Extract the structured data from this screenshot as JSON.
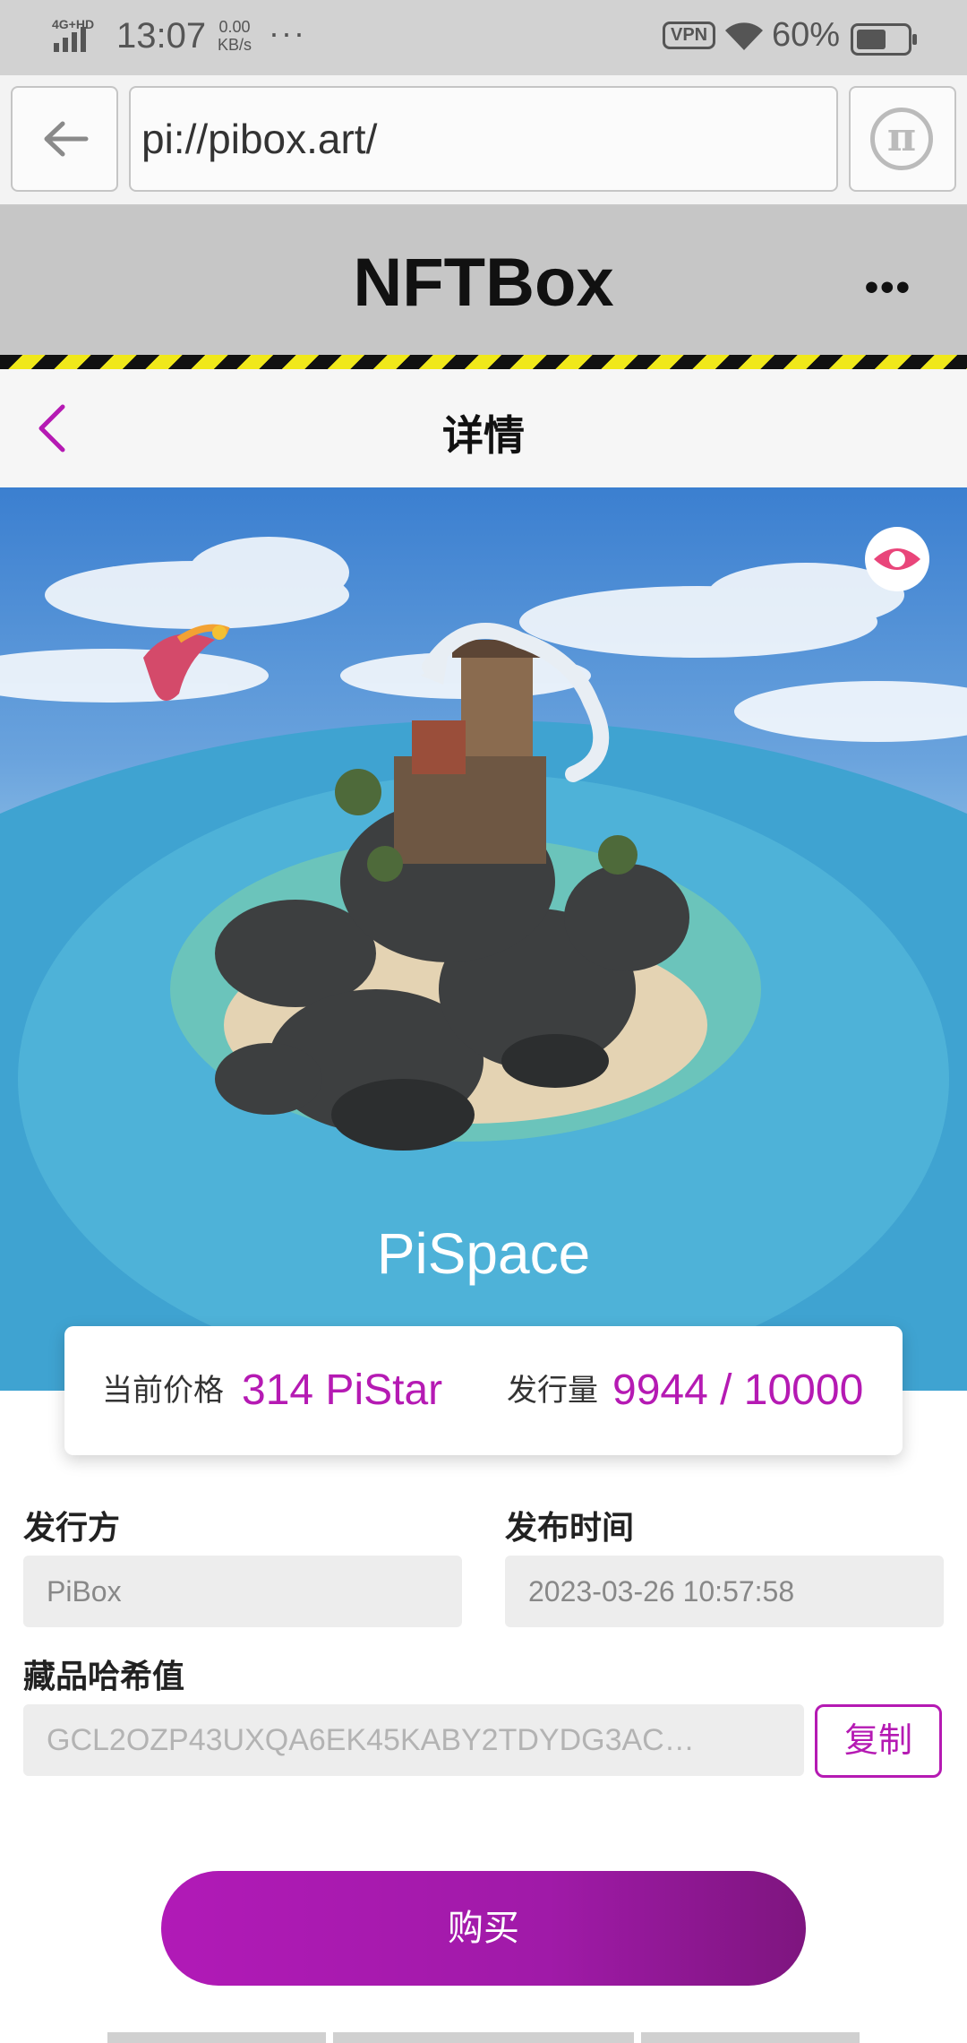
{
  "status_bar": {
    "network": "4G+HD",
    "time": "13:07",
    "speed_value": "0.00",
    "speed_unit": "KB/s",
    "more": "···",
    "vpn": "VPN",
    "battery_pct": "60%",
    "battery_level": 0.6
  },
  "browser": {
    "url": "pi://pibox.art/",
    "pi_icon": "π"
  },
  "app_header": {
    "title": "NFTBox",
    "more": "•••"
  },
  "detail_nav": {
    "title": "详情"
  },
  "nft": {
    "name": "PiSpace"
  },
  "price_card": {
    "price_label": "当前价格",
    "price_value": "314 PiStar",
    "supply_label": "发行量",
    "supply_value": "9944 / 10000"
  },
  "fields": {
    "issuer_label": "发行方",
    "issuer_value": "PiBox",
    "release_label": "发布时间",
    "release_value": "2023-03-26 10:57:58",
    "hash_label": "藏品哈希值",
    "hash_value": "GCL2OZP43UXQA6EK45KABY2TDYDG3AC…",
    "copy_label": "复制"
  },
  "buy_label": "购买",
  "colors": {
    "accent": "#b51ab3",
    "header_bg": "#c6c6c6",
    "hazard_yellow": "#f0e81a"
  }
}
